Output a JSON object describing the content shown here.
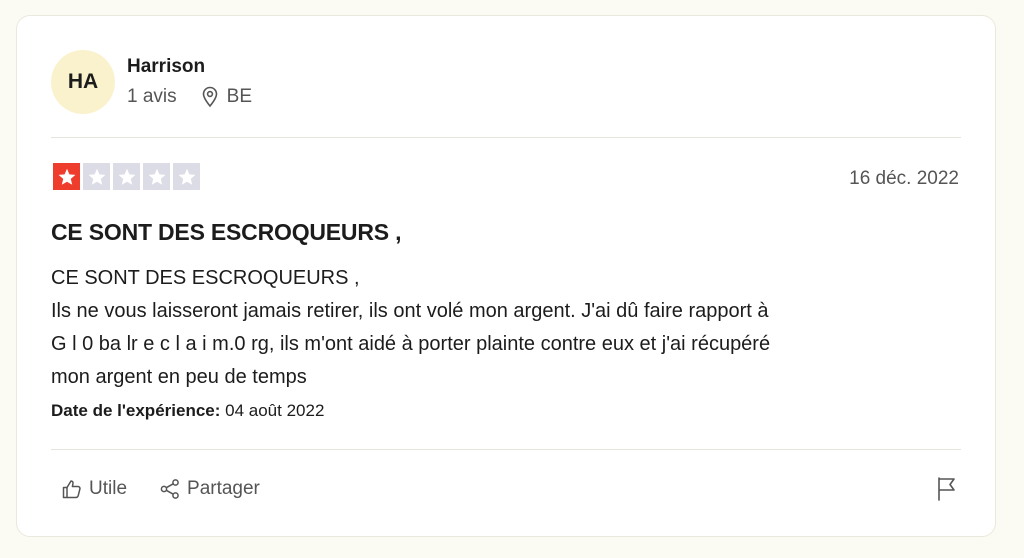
{
  "reviewer": {
    "initials": "HA",
    "name": "Harrison",
    "review_count": "1 avis",
    "country": "BE"
  },
  "review": {
    "rating": 1,
    "rating_max": 5,
    "date": "16 déc. 2022",
    "title": "CE SONT DES ESCROQUEURS ,",
    "body_lines": [
      "CE SONT DES ESCROQUEURS ,",
      "Ils ne vous laisseront jamais retirer, ils ont volé mon argent. J'ai dû faire rapport à",
      "G l 0 ba lr e c l a i m.0 rg, ils m'ont aidé à porter plainte contre eux et j'ai récupéré",
      "mon argent en peu de temps"
    ],
    "experience_label": "Date de l'expérience:",
    "experience_date": "04 août 2022"
  },
  "actions": {
    "useful_label": "Utile",
    "share_label": "Partager"
  },
  "icons": {
    "location": "location-pin-icon",
    "useful": "thumbs-up-icon",
    "share": "share-icon",
    "report": "flag-icon",
    "star": "star-icon"
  },
  "colors": {
    "star_on": "#ee3d2c",
    "star_off": "#dcdce6",
    "avatar_bg": "#faf2cd"
  }
}
